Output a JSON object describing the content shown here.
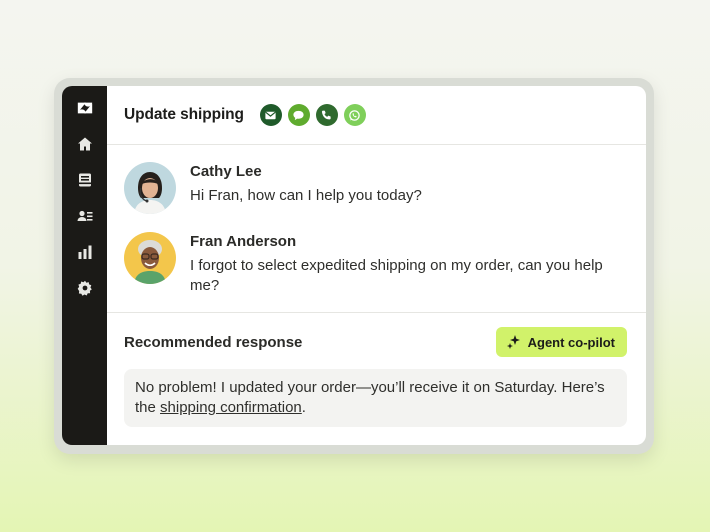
{
  "header": {
    "title": "Update shipping",
    "channels": [
      {
        "icon": "email-icon",
        "color": "#1f5a2a"
      },
      {
        "icon": "chat-icon",
        "color": "#5fab2e"
      },
      {
        "icon": "phone-icon",
        "color": "#2f6a2e"
      },
      {
        "icon": "whatsapp-icon",
        "color": "#7fcf5a"
      }
    ]
  },
  "sidebar": {
    "items": [
      "zendesk-logo-icon",
      "home-icon",
      "tickets-icon",
      "contacts-icon",
      "reports-icon",
      "settings-icon"
    ]
  },
  "conversation": {
    "messages": [
      {
        "name": "Cathy Lee",
        "text": "Hi Fran, how can I help you today?"
      },
      {
        "name": "Fran Anderson",
        "text": "I forgot to select expedited shipping on my order, can you help me?"
      }
    ]
  },
  "recommended": {
    "title": "Recommended response",
    "copilot_label": "Agent co-pilot",
    "response_text": "No problem! I updated your order—you’ll receive it on Saturday. Here’s the ",
    "response_link": "shipping confirmation",
    "response_end": "."
  },
  "colors": {
    "accent": "#d1f26a",
    "rail": "#1b1a17"
  }
}
